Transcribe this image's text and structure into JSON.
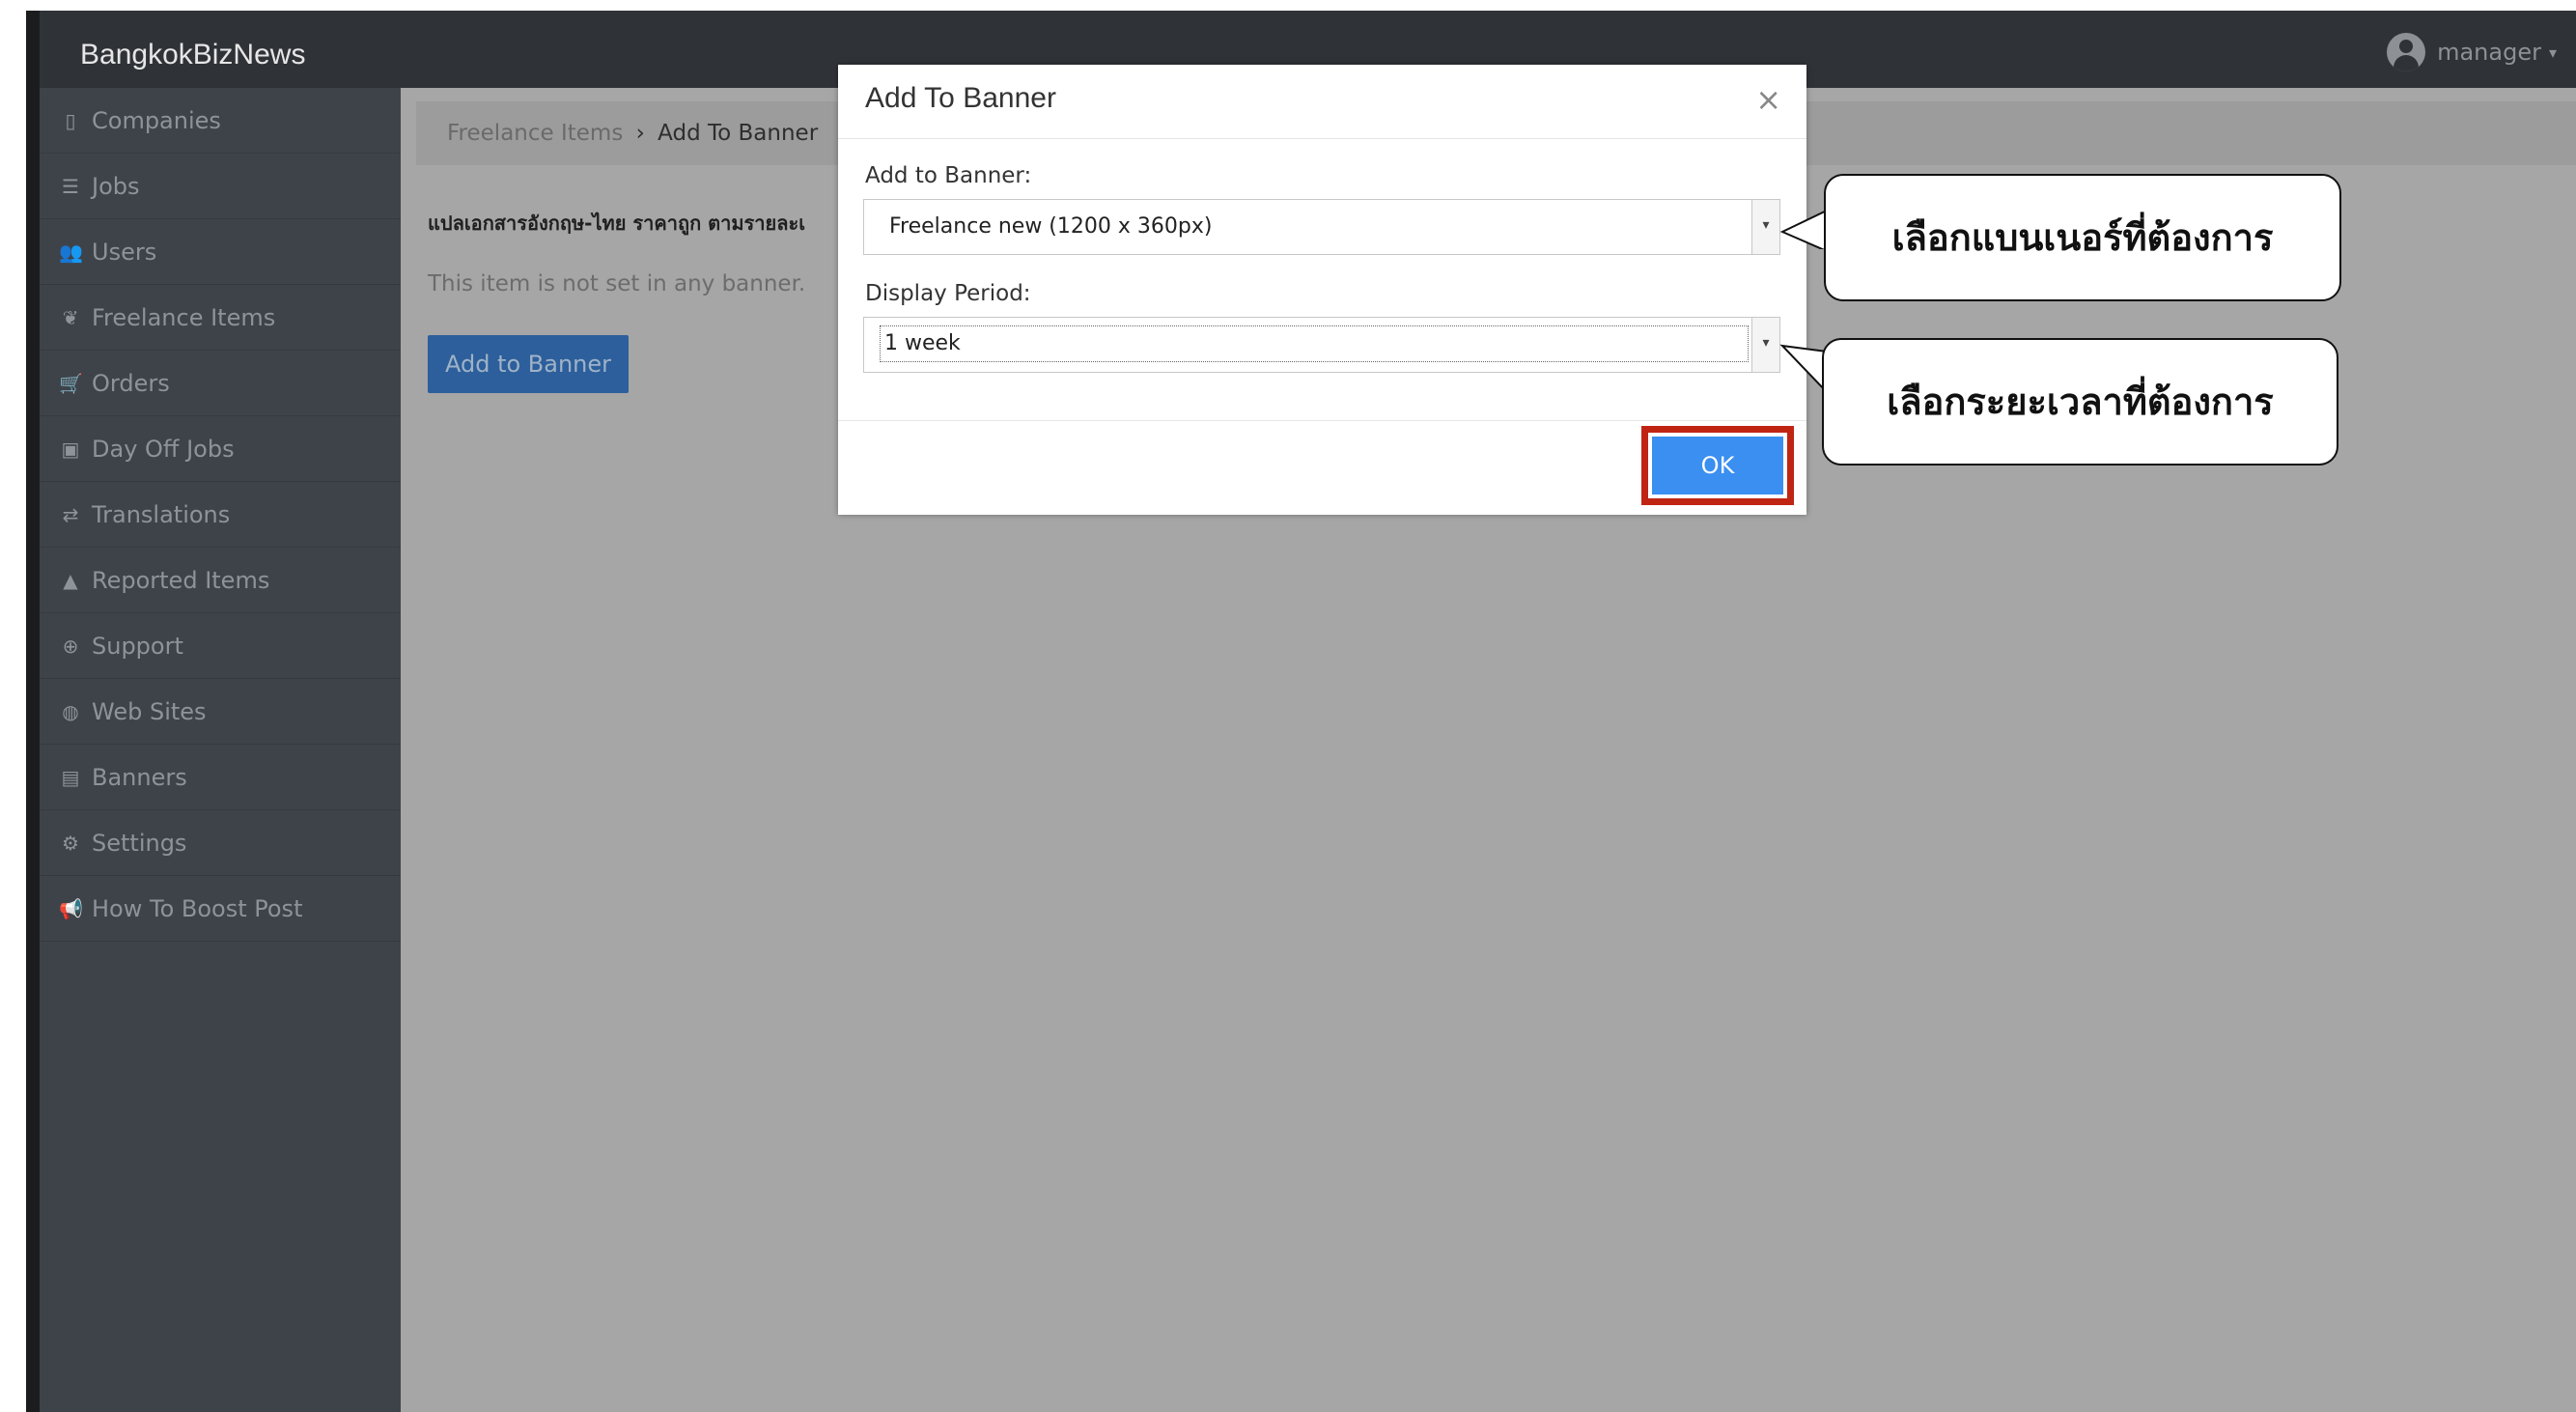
{
  "app": {
    "brand": "BangkokBizNews",
    "user_name": "manager",
    "user_caret": "▾"
  },
  "sidebar": {
    "items": [
      {
        "icon": "building-icon",
        "glyph": "▯",
        "label": "Companies"
      },
      {
        "icon": "list-icon",
        "glyph": "☰",
        "label": "Jobs"
      },
      {
        "icon": "users-icon",
        "glyph": "👥",
        "label": "Users"
      },
      {
        "icon": "handshake-icon",
        "glyph": "❦",
        "label": "Freelance Items"
      },
      {
        "icon": "cart-icon",
        "glyph": "🛒",
        "label": "Orders"
      },
      {
        "icon": "calendar-icon",
        "glyph": "▣",
        "label": "Day Off Jobs"
      },
      {
        "icon": "translate-icon",
        "glyph": "⇄",
        "label": "Translations"
      },
      {
        "icon": "warning-icon",
        "glyph": "▲",
        "label": "Reported Items"
      },
      {
        "icon": "support-icon",
        "glyph": "⊕",
        "label": "Support"
      },
      {
        "icon": "globe-icon",
        "glyph": "◍",
        "label": "Web Sites"
      },
      {
        "icon": "banner-icon",
        "glyph": "▤",
        "label": "Banners"
      },
      {
        "icon": "gears-icon",
        "glyph": "⚙",
        "label": "Settings"
      },
      {
        "icon": "megaphone-icon",
        "glyph": "📢",
        "label": "How To Boost Post"
      }
    ]
  },
  "main": {
    "breadcrumb_root": "Freelance Items",
    "breadcrumb_sep": "›",
    "breadcrumb_current": "Add To Banner",
    "item_title": "แปลเอกสารอังกฤษ-ไทย ราคาถูก ตามรายละเ",
    "status_text": "This item is not set in any banner.",
    "add_button": "Add to Banner"
  },
  "modal": {
    "title": "Add To Banner",
    "close": "×",
    "banner_label": "Add to Banner:",
    "banner_value": "Freelance new (1200 x 360px)",
    "period_label": "Display Period:",
    "period_value": "1 week",
    "ok": "OK"
  },
  "callouts": {
    "banner": "เลือกแบนเนอร์ที่ต้องการ",
    "period": "เลือกระยะเวลาที่ต้องการ"
  },
  "colors": {
    "ok_highlight": "#c02514",
    "ok_button": "#3a8ff0",
    "sidebar_bg": "#3e434a",
    "overlay_bg": "#a6a6a6"
  }
}
